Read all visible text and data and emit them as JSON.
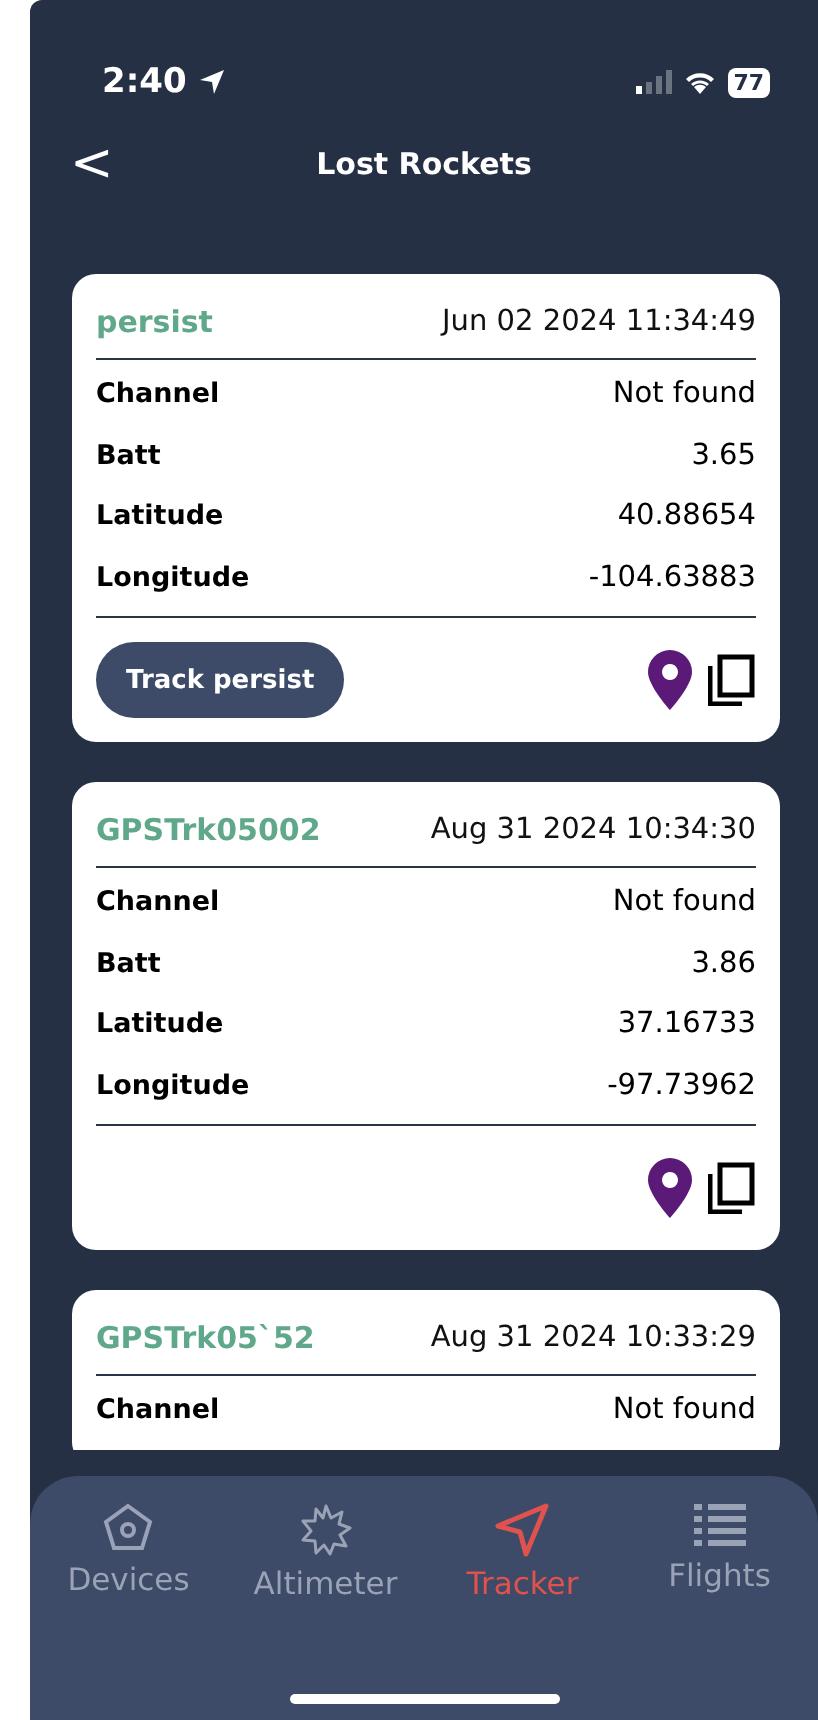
{
  "status_bar": {
    "time": "2:40",
    "battery": "77"
  },
  "header": {
    "back": "<",
    "title": "Lost Rockets"
  },
  "cards": [
    {
      "name": "persist",
      "timestamp": "Jun 02 2024 11:34:49",
      "rows": [
        {
          "label": "Channel",
          "value": "Not found"
        },
        {
          "label": "Batt",
          "value": "3.65"
        },
        {
          "label": "Latitude",
          "value": "40.88654"
        },
        {
          "label": "Longitude",
          "value": "-104.63883"
        }
      ],
      "track_button": "Track persist"
    },
    {
      "name": "GPSTrk05002",
      "timestamp": "Aug 31 2024 10:34:30",
      "rows": [
        {
          "label": "Channel",
          "value": "Not found"
        },
        {
          "label": "Batt",
          "value": "3.86"
        },
        {
          "label": "Latitude",
          "value": "37.16733"
        },
        {
          "label": "Longitude",
          "value": "-97.73962"
        }
      ]
    },
    {
      "name": "GPSTrk05`52",
      "timestamp": "Aug 31 2024 10:33:29",
      "rows": [
        {
          "label": "Channel",
          "value": "Not found"
        }
      ]
    }
  ],
  "tabs": [
    {
      "kind": "devices",
      "label": "Devices",
      "selected": false
    },
    {
      "kind": "altimeter",
      "label": "Altimeter",
      "selected": false
    },
    {
      "kind": "tracker",
      "label": "Tracker",
      "selected": true
    },
    {
      "kind": "flights",
      "label": "Flights",
      "selected": false
    }
  ]
}
